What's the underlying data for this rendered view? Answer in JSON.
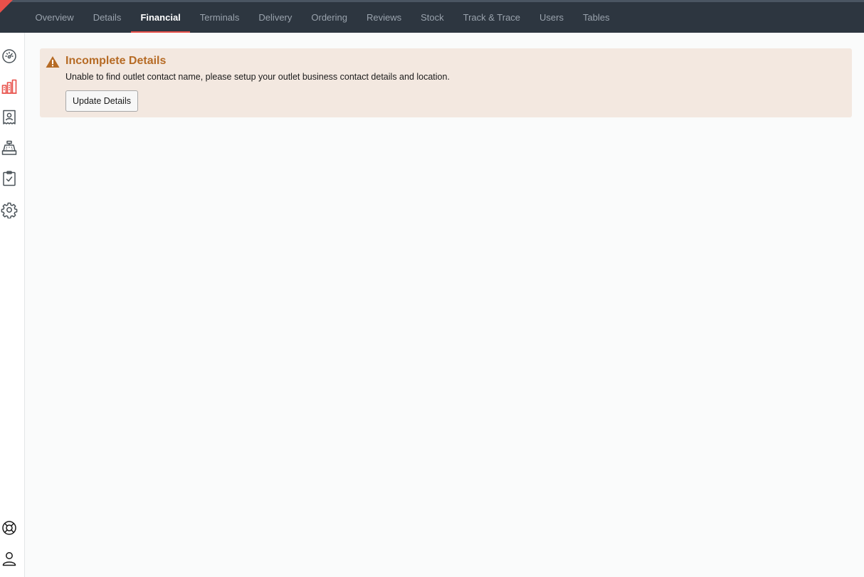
{
  "tabs": [
    {
      "label": "Overview",
      "active": false
    },
    {
      "label": "Details",
      "active": false
    },
    {
      "label": "Financial",
      "active": true
    },
    {
      "label": "Terminals",
      "active": false
    },
    {
      "label": "Delivery",
      "active": false
    },
    {
      "label": "Ordering",
      "active": false
    },
    {
      "label": "Reviews",
      "active": false
    },
    {
      "label": "Stock",
      "active": false
    },
    {
      "label": "Track & Trace",
      "active": false
    },
    {
      "label": "Users",
      "active": false
    },
    {
      "label": "Tables",
      "active": false
    }
  ],
  "sidebar": {
    "items": [
      {
        "icon": "dashboard-gauge-icon",
        "active": false
      },
      {
        "icon": "financial-chart-icon",
        "active": true
      },
      {
        "icon": "profile-card-icon",
        "active": false
      },
      {
        "icon": "till-register-icon",
        "active": false
      },
      {
        "icon": "clipboard-check-icon",
        "active": false
      },
      {
        "icon": "settings-gear-icon",
        "active": false
      }
    ],
    "bottom_items": [
      {
        "icon": "help-lifebuoy-icon"
      },
      {
        "icon": "user-account-icon"
      }
    ]
  },
  "alert": {
    "title": "Incomplete Details",
    "message": "Unable to find outlet contact name, please setup your outlet business contact details and location.",
    "button_label": "Update Details"
  },
  "colors": {
    "topbar": "#2d3640",
    "accent": "#e8504a",
    "tab_inactive": "#9aa3ad",
    "alert_bg": "#f3e8e0",
    "alert_title": "#b66b25",
    "icon": "#4a5258"
  }
}
